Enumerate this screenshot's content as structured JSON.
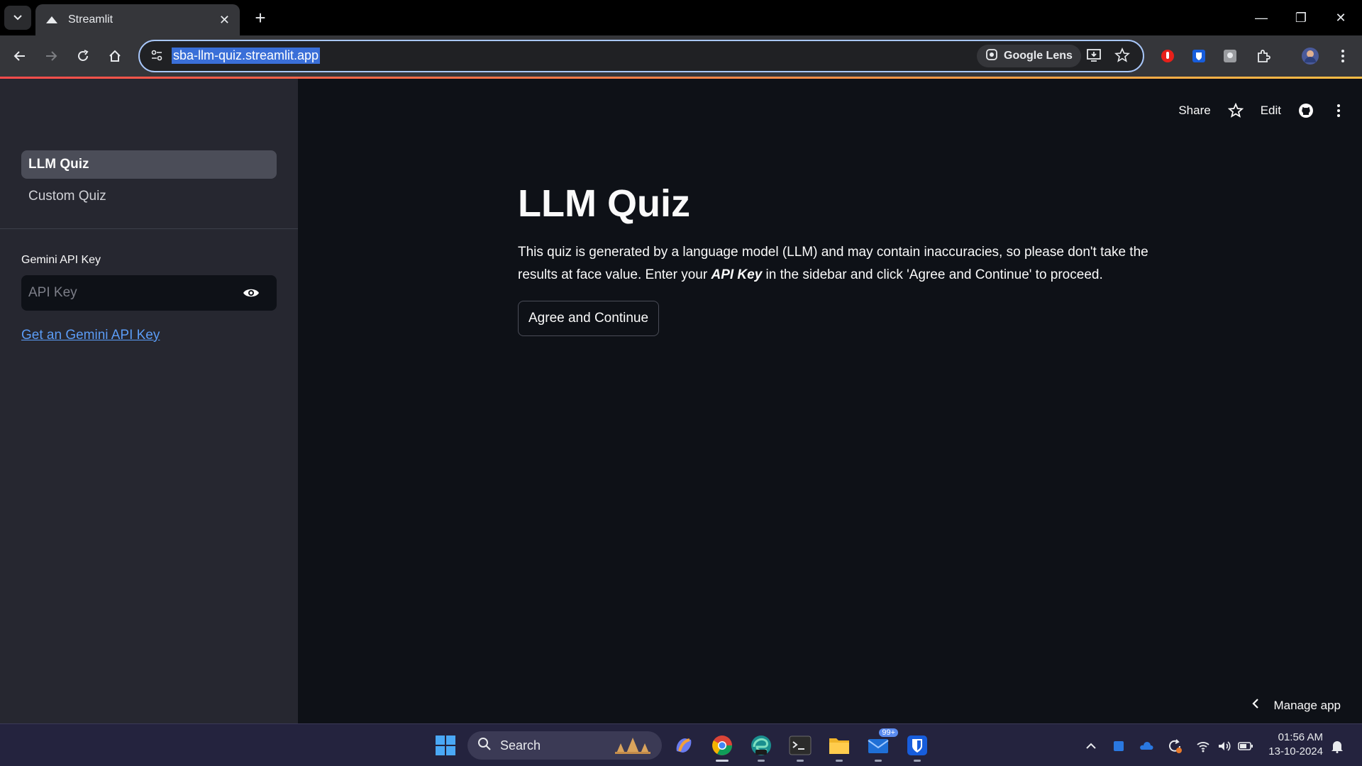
{
  "browser": {
    "tab_title": "Streamlit",
    "url": "sba-llm-quiz.streamlit.app",
    "lens_label": "Google Lens"
  },
  "sidebar": {
    "nav_items": [
      {
        "label": "LLM Quiz",
        "active": true
      },
      {
        "label": "Custom Quiz",
        "active": false
      }
    ],
    "api_key_label": "Gemini API Key",
    "api_key_placeholder": "API Key",
    "api_key_link": "Get an Gemini API Key"
  },
  "header": {
    "share_label": "Share",
    "edit_label": "Edit"
  },
  "main": {
    "title": "LLM Quiz",
    "desc_part1": "This quiz is generated by a language model (LLM) and may contain inaccuracies, so please don't take the results at face value. Enter your ",
    "desc_emph": "API Key",
    "desc_part2": " in the sidebar and click 'Agree and Continue' to proceed.",
    "agree_button": "Agree and Continue"
  },
  "manage_app_label": "Manage app",
  "taskbar": {
    "search_label": "Search",
    "mail_badge": "99+",
    "time": "01:56 AM",
    "date": "13-10-2024"
  },
  "colors": {
    "accent_gradient_start": "#ff4b4b",
    "accent_gradient_end": "#ffbd45",
    "link": "#5b9cf6",
    "background": "#0e1117",
    "sidebar": "#262730"
  }
}
